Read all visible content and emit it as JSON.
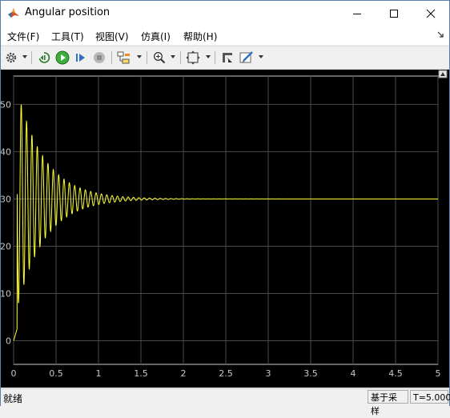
{
  "window": {
    "title": "Angular position",
    "app_icon": "matlab-logo-icon",
    "controls": {
      "minimize": "minimize-icon",
      "maximize": "maximize-icon",
      "close": "close-icon"
    }
  },
  "menu": {
    "items": [
      "文件(F)",
      "工具(T)",
      "视图(V)",
      "仿真(I)",
      "帮助(H)"
    ]
  },
  "toolbar": {
    "icons": [
      "settings-gear-icon",
      "step-back-icon",
      "run-icon",
      "step-forward-icon",
      "stop-icon",
      "signal-hierarchy-icon",
      "zoom-icon",
      "fit-to-view-icon",
      "restore-icon",
      "style-pen-icon"
    ]
  },
  "plot": {
    "background": "#000000",
    "grid_color": "#4a4a4a",
    "axis_color": "#c8c8c8",
    "signal_color": "#ffff33",
    "x_ticks": [
      "0",
      "0.5",
      "1",
      "1.5",
      "2",
      "2.5",
      "3",
      "3.5",
      "4",
      "4.5",
      "5"
    ],
    "y_ticks": [
      "0",
      "10",
      "20",
      "30",
      "40",
      "50"
    ]
  },
  "chart_data": {
    "type": "line",
    "xlim": [
      0,
      5
    ],
    "ylim": [
      -5,
      56
    ],
    "grid": true,
    "series": [
      {
        "color": "#ffff33",
        "model": "damped oscillation settling to steady state",
        "final_value": 30,
        "peak_value": 50,
        "peak_time": 0.09,
        "oscillation_period": 0.063,
        "decay_rate": 3.1,
        "t_end": 5
      }
    ]
  },
  "status": {
    "left": "就绪",
    "mode": "基于采样",
    "time": "T=5.000"
  }
}
